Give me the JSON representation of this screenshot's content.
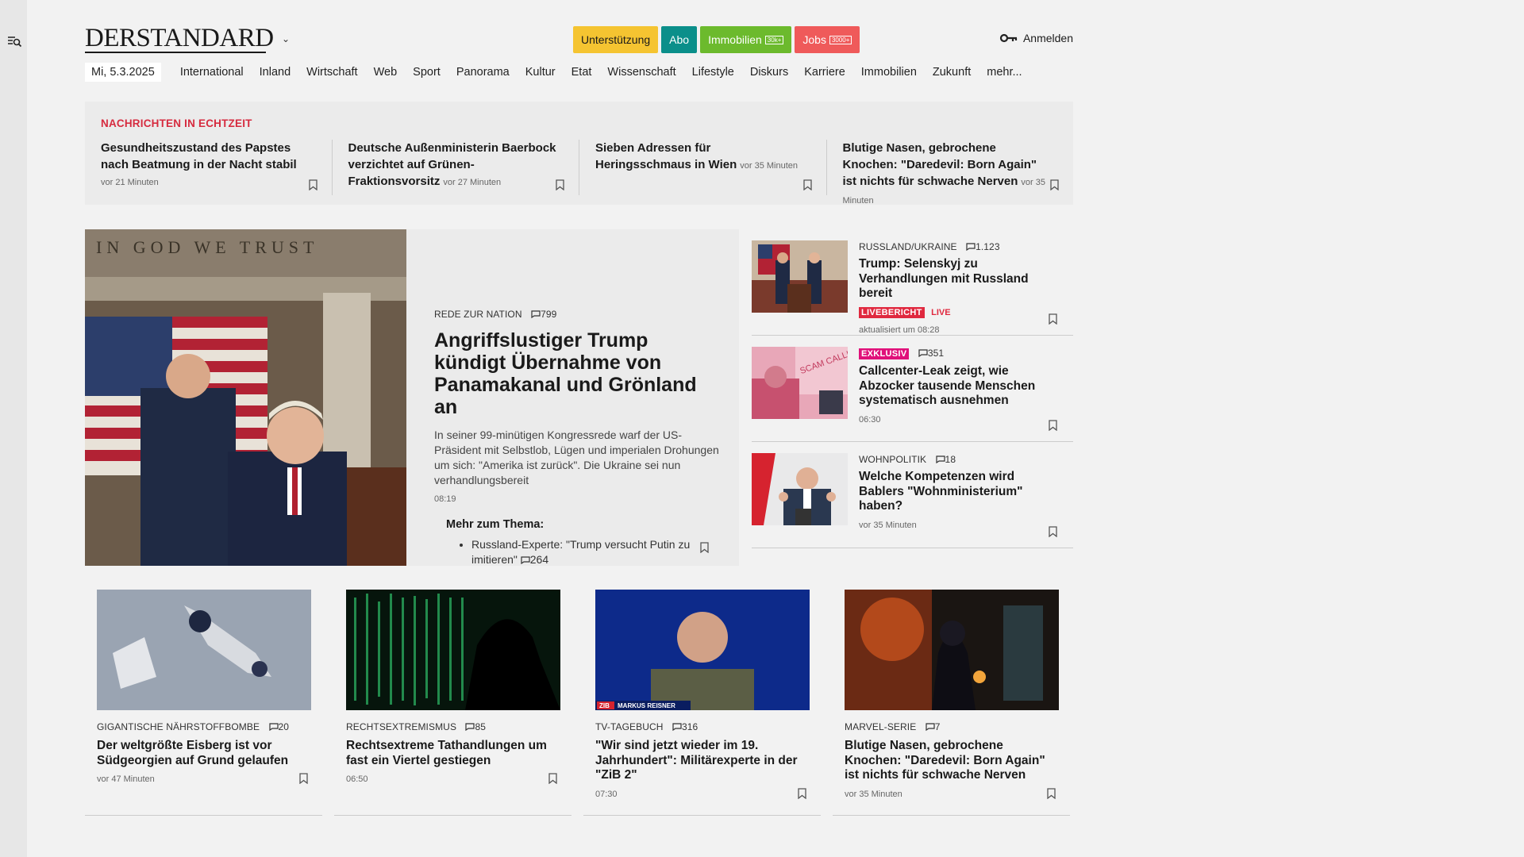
{
  "header": {
    "logo": "DERSTANDARD",
    "pills": [
      {
        "label": "Unterstützung",
        "bg": "#f5c431",
        "color": "#1a1a1a",
        "tag": ""
      },
      {
        "label": "Abo",
        "bg": "#0b8f8a",
        "color": "#ffffff",
        "tag": ""
      },
      {
        "label": "Immobilien",
        "bg": "#6cba2d",
        "color": "#ffffff",
        "tag": "30k+"
      },
      {
        "label": "Jobs",
        "bg": "#ef5a5a",
        "color": "#ffffff",
        "tag": "3000+"
      }
    ],
    "login": "Anmelden"
  },
  "nav": {
    "date": "Mi, 5.3.2025",
    "items": [
      "International",
      "Inland",
      "Wirtschaft",
      "Web",
      "Sport",
      "Panorama",
      "Kultur",
      "Etat",
      "Wissenschaft",
      "Lifestyle",
      "Diskurs",
      "Karriere",
      "Immobilien",
      "Zukunft",
      "mehr..."
    ]
  },
  "ticker": {
    "title": "NACHRICHTEN IN ECHTZEIT",
    "items": [
      {
        "text": "Gesundheitszustand des Papstes nach Beatmung in der Nacht stabil",
        "time": "vor 21 Minuten"
      },
      {
        "text": "Deutsche Außenministerin Baerbock verzichtet auf Grünen-Fraktionsvorsitz",
        "time": "vor 27 Minuten"
      },
      {
        "text": "Sieben Adressen für Heringsschmaus in Wien",
        "time": "vor 35 Minuten"
      },
      {
        "text": "Blutige Nasen, gebrochene Knochen: \"Daredevil: Born Again\" ist nichts für schwache Nerven",
        "time": "vor 35 Minuten"
      }
    ]
  },
  "lead": {
    "image_text": "IN GOD WE TRUST",
    "kicker": "REDE ZUR NATION",
    "comments": "799",
    "title": "Angriffslustiger Trump kündigt Übernahme von Panamakanal und Grönland an",
    "teaser": "In seiner 99-minütigen Kongressrede warf der US-Präsident mit Selbstlob, Lügen und imperialen Drohungen um sich: \"Amerika ist zurück\". Die Ukraine sei nun verhandlungsbereit",
    "time": "08:19",
    "more_title": "Mehr zum Thema:",
    "more_item": "Russland-Experte: \"Trump versucht Putin zu imitieren\"",
    "more_comments": "264"
  },
  "side": [
    {
      "kicker": "RUSSLAND/UKRAINE",
      "comments": "1.123",
      "title": "Trump: Selenskyj zu Verhandlungen mit Russland bereit",
      "badge": "LIVEBERICHT",
      "live": "LIVE",
      "time": "aktualisiert um 08:28"
    },
    {
      "kicker": "",
      "badge": "EXKLUSIV",
      "comments": "351",
      "title": "Callcenter-Leak zeigt, wie Abzocker tausende Menschen systematisch ausnehmen",
      "time": "06:30",
      "image_text": "SCAM CALLING"
    },
    {
      "kicker": "WOHNPOLITIK",
      "comments": "18",
      "title": "Welche Kompetenzen wird Bablers \"Wohnministerium\" haben?",
      "time": "vor 35 Minuten"
    }
  ],
  "bottom": [
    {
      "kicker": "GIGANTISCHE NÄHRSTOFFBOMBE",
      "comments": "20",
      "title": "Der weltgrößte Eisberg ist vor Südgeorgien auf Grund gelaufen",
      "time": "vor 47 Minuten"
    },
    {
      "kicker": "RECHTSEXTREMISMUS",
      "comments": "85",
      "title": "Rechtsextreme Tathandlungen um fast ein Viertel gestiegen",
      "time": "06:50"
    },
    {
      "kicker": "TV-TAGEBUCH",
      "comments": "316",
      "title": "\"Wir sind jetzt wieder im 19. Jahrhundert\": Militärexperte in der \"ZiB 2\"",
      "time": "07:30",
      "image_logo": "ZIB",
      "image_caption": "MARKUS REISNER"
    },
    {
      "kicker": "MARVEL-SERIE",
      "comments": "7",
      "title": "Blutige Nasen, gebrochene Knochen: \"Daredevil: Born Again\" ist nichts für schwache Nerven",
      "time": "vor 35 Minuten"
    }
  ],
  "colors": {
    "accent_red": "#d62b3f",
    "exklusiv": "#e0107a",
    "live": "#e0293f"
  }
}
